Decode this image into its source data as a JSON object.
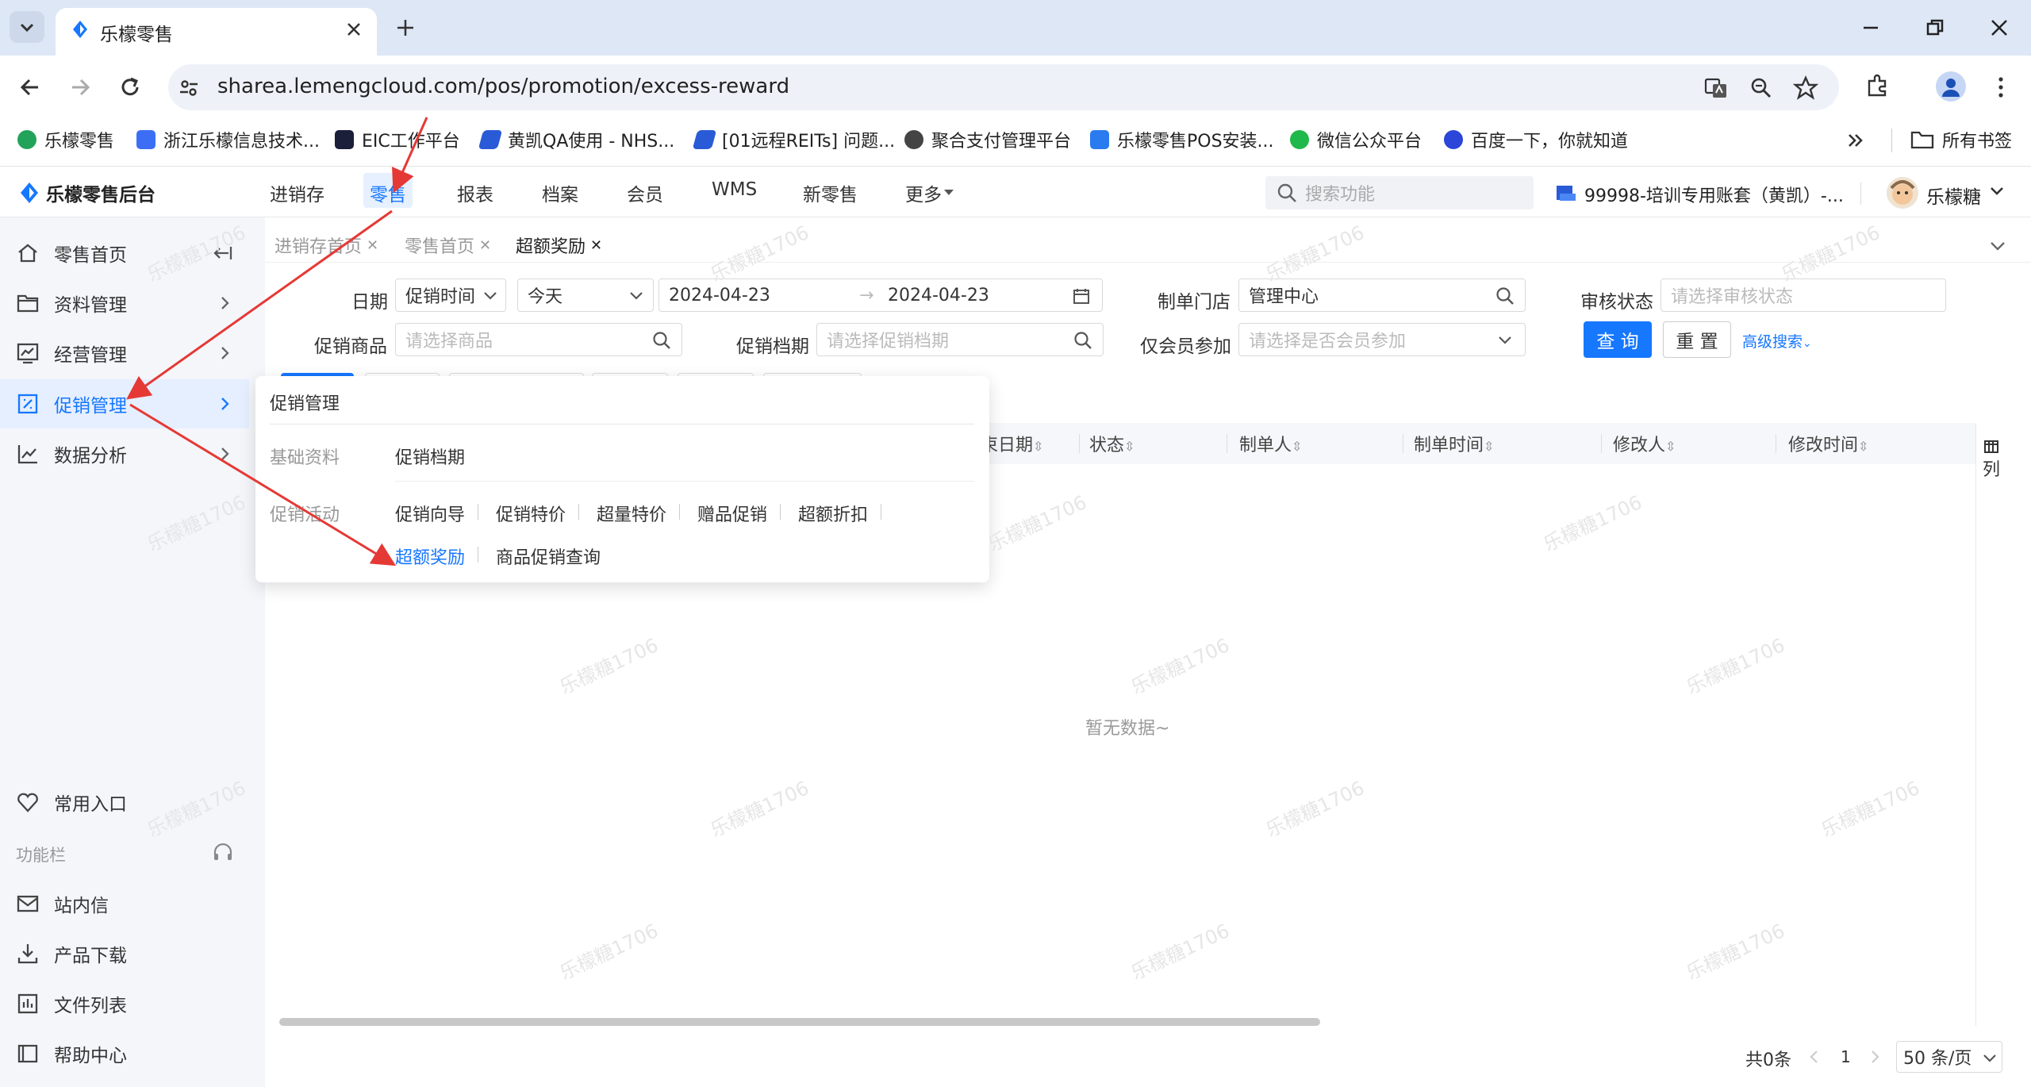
{
  "browser": {
    "tab_title": "乐檬零售",
    "url": "sharea.lemengcloud.com/pos/promotion/excess-reward",
    "bookmarks": [
      "乐檬零售",
      "浙江乐檬信息技术...",
      "EIC工作平台",
      "黄凯QA使用 - NHS...",
      "[01远程REITs] 问题...",
      "聚合支付管理平台",
      "乐檬零售POS安装...",
      "微信公众平台",
      "百度一下，你就知道"
    ],
    "all_bookmarks": "所有书签"
  },
  "app": {
    "logo": "乐檬零售后台",
    "nav": [
      "进销存",
      "零售",
      "报表",
      "档案",
      "会员",
      "WMS",
      "新零售",
      "更多"
    ],
    "search_placeholder": "搜索功能",
    "account": "99998-培训专用账套（黄凯）-...",
    "user": "乐檬糖"
  },
  "sidebar": {
    "items": [
      "零售首页",
      "资料管理",
      "经营管理",
      "促销管理",
      "数据分析"
    ],
    "common": "常用入口",
    "function_bar": "功能栏",
    "bottom": [
      "站内信",
      "产品下载",
      "文件列表",
      "帮助中心"
    ]
  },
  "page_tabs": [
    "进销存首页",
    "零售首页",
    "超额奖励"
  ],
  "filters": {
    "date_label": "日期",
    "date_type": "促销时间",
    "date_range": "今天",
    "start_date": "2024-04-23",
    "end_date": "2024-04-23",
    "store_label": "制单门店",
    "store_value": "管理中心",
    "audit_label": "审核状态",
    "audit_placeholder": "请选择审核状态",
    "product_label": "促销商品",
    "product_placeholder": "请选择商品",
    "period_label": "促销档期",
    "period_placeholder": "请选择促销档期",
    "member_label": "仅会员参加",
    "member_placeholder": "请选择是否会员参加",
    "query_button": "查 询",
    "reset_button": "重 置",
    "advanced_link": "高级搜索"
  },
  "table": {
    "headers": [
      "束日期",
      "状态",
      "制单人",
      "制单时间",
      "修改人",
      "修改时间"
    ],
    "column_setting": "列",
    "empty": "暂无数据~"
  },
  "pagination": {
    "total": "共0条",
    "page": "1",
    "page_size": "50 条/页"
  },
  "dropdown": {
    "title": "促销管理",
    "groups": [
      {
        "label": "基础资料",
        "items": [
          "促销档期"
        ]
      },
      {
        "label": "促销活动",
        "items": [
          "促销向导",
          "促销特价",
          "超量特价",
          "赠品促销",
          "超额折扣",
          "超额奖励",
          "商品促销查询"
        ]
      }
    ]
  },
  "watermark": "乐檬糖1706",
  "colors": {
    "primary": "#1677ff",
    "arrow": "#e53935",
    "chrome": "#dee7f6"
  }
}
